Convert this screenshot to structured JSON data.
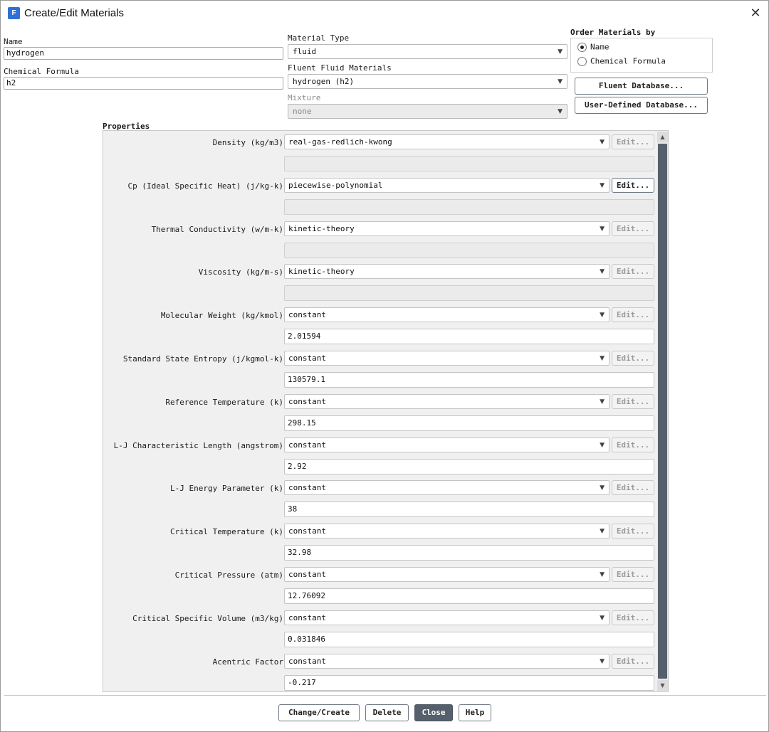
{
  "window": {
    "title": "Create/Edit Materials",
    "icon_letter": "F",
    "close_glyph": "✕"
  },
  "name_field": {
    "label": "Name",
    "value": "hydrogen"
  },
  "formula_field": {
    "label": "Chemical Formula",
    "value": "h2"
  },
  "material_type": {
    "label": "Material Type",
    "value": "fluid"
  },
  "fluent_materials": {
    "label": "Fluent Fluid Materials",
    "value": "hydrogen (h2)"
  },
  "mixture": {
    "label": "Mixture",
    "value": "none"
  },
  "order_by": {
    "label": "Order Materials by",
    "options": [
      {
        "label": "Name",
        "checked": true
      },
      {
        "label": "Chemical Formula",
        "checked": false
      }
    ]
  },
  "database_buttons": {
    "fluent": "Fluent Database...",
    "user_defined": "User-Defined Database..."
  },
  "properties": {
    "heading": "Properties",
    "edit_label": "Edit...",
    "rows": [
      {
        "label": "Density (kg/m3)",
        "method": "real-gas-redlich-kwong",
        "value": "",
        "edit_active": false
      },
      {
        "label": "Cp (Ideal Specific Heat) (j/kg-k)",
        "method": "piecewise-polynomial",
        "value": "",
        "edit_active": true
      },
      {
        "label": "Thermal Conductivity (w/m-k)",
        "method": "kinetic-theory",
        "value": "",
        "edit_active": false
      },
      {
        "label": "Viscosity (kg/m-s)",
        "method": "kinetic-theory",
        "value": "",
        "edit_active": false
      },
      {
        "label": "Molecular Weight (kg/kmol)",
        "method": "constant",
        "value": "2.01594",
        "edit_active": false
      },
      {
        "label": "Standard State Entropy (j/kgmol-k)",
        "method": "constant",
        "value": "130579.1",
        "edit_active": false
      },
      {
        "label": "Reference Temperature (k)",
        "method": "constant",
        "value": "298.15",
        "edit_active": false
      },
      {
        "label": "L-J Characteristic Length (angstrom)",
        "method": "constant",
        "value": "2.92",
        "edit_active": false
      },
      {
        "label": "L-J Energy Parameter (k)",
        "method": "constant",
        "value": "38",
        "edit_active": false
      },
      {
        "label": "Critical Temperature (k)",
        "method": "constant",
        "value": "32.98",
        "edit_active": false
      },
      {
        "label": "Critical Pressure (atm)",
        "method": "constant",
        "value": "12.76092",
        "edit_active": false
      },
      {
        "label": "Critical Specific Volume (m3/kg)",
        "method": "constant",
        "value": "0.031846",
        "edit_active": false
      },
      {
        "label": "Acentric Factor",
        "method": "constant",
        "value": "-0.217",
        "edit_active": false
      }
    ]
  },
  "footer_buttons": {
    "change_create": "Change/Create",
    "delete": "Delete",
    "close": "Close",
    "help": "Help"
  },
  "colors": {
    "accent": "#56606c",
    "app_icon": "#2f6fd6",
    "panel_bg": "#f0f0f0"
  }
}
